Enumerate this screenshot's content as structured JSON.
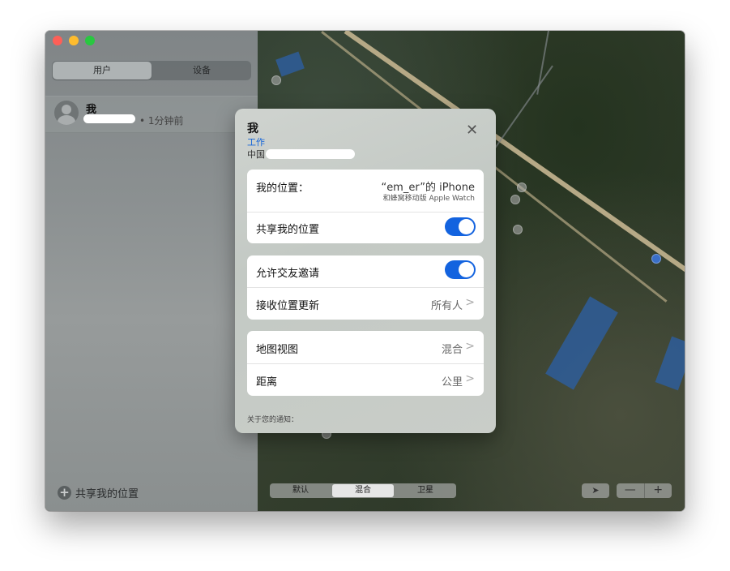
{
  "sidebar": {
    "tabs": [
      {
        "label": "用户",
        "active": true
      },
      {
        "label": "设备",
        "active": false
      }
    ],
    "user": {
      "name": "我",
      "time": "• 1分钟前"
    },
    "share_button": "共享我的位置"
  },
  "popover": {
    "title": "我",
    "subtitle": "工作",
    "country": "中国",
    "my_location": {
      "label": "我的位置：",
      "device": "“em_er”的 iPhone",
      "device_sub": "和蜂窝移动版 Apple Watch"
    },
    "share_location": {
      "label": "共享我的位置",
      "enabled": true
    },
    "allow_invites": {
      "label": "允许交友邀请",
      "enabled": true
    },
    "receive_updates": {
      "label": "接收位置更新",
      "value": "所有人"
    },
    "map_view": {
      "label": "地图视图",
      "value": "混合"
    },
    "distance": {
      "label": "距离",
      "value": "公里"
    },
    "about": "关于您的通知："
  },
  "map": {
    "modes": [
      {
        "label": "默认",
        "active": false
      },
      {
        "label": "混合",
        "active": true
      },
      {
        "label": "卫星",
        "active": false
      }
    ],
    "zoom_out": "—",
    "zoom_in": "+"
  },
  "colors": {
    "accent": "#1363df",
    "link": "#1565d8"
  }
}
